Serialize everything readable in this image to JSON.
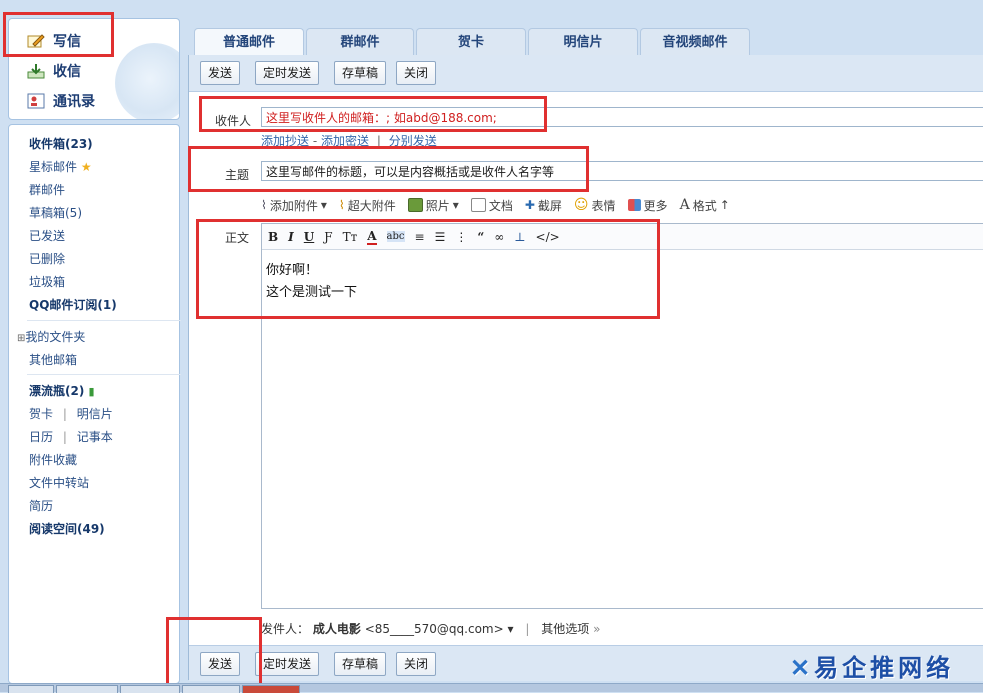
{
  "left_top": {
    "write": "写信",
    "receive": "收信",
    "contacts": "通讯录"
  },
  "nav": {
    "inbox": "收件箱(23)",
    "starred": "星标邮件",
    "group": "群邮件",
    "drafts": "草稿箱(5)",
    "sent": "已发送",
    "deleted": "已删除",
    "trash": "垃圾箱",
    "subscribe": "QQ邮件订阅(1)",
    "my_folders": "我的文件夹",
    "other_mail": "其他邮箱",
    "drift_bottle": "漂流瓶(2)",
    "greeting_card": "贺卡",
    "postcard": "明信片",
    "calendar": "日历",
    "notes": "记事本",
    "attach_fav": "附件收藏",
    "file_transfer": "文件中转站",
    "resume": "简历",
    "reading": "阅读空间(49)",
    "divider": "|"
  },
  "tabs": [
    "普通邮件",
    "群邮件",
    "贺卡",
    "明信片",
    "音视频邮件"
  ],
  "toolbar": {
    "send": "发送",
    "timed_send": "定时发送",
    "save_draft": "存草稿",
    "close": "关闭"
  },
  "compose": {
    "to_label": "收件人",
    "to_value": "这里写收件人的邮箱：; 如abd@188.com;",
    "add_cc": "添加抄送",
    "add_bcc": "添加密送",
    "split_send": "分别发送",
    "subject_label": "主题",
    "subject_value": "这里写邮件的标题，可以是内容概括或是收件人名字等",
    "body_label": "正文",
    "body_line1": "你好啊！",
    "body_line2": "这个是测试一下",
    "dash": "-",
    "bar": "|"
  },
  "attach_bar": {
    "add_attachment": "添加附件",
    "big_attachment": "超大附件",
    "photo": "照片",
    "document": "文档",
    "screenshot": "截屏",
    "emoji": "表情",
    "more": "更多",
    "format": "格式"
  },
  "format_bar": [
    "B",
    "I",
    "U",
    "Ƒ",
    "Tт",
    "A",
    "abc",
    "≡",
    "☰",
    "⋮",
    "“",
    "∞",
    "⊥",
    "</>"
  ],
  "sender": {
    "label": "发件人：",
    "name": "成人电影",
    "email": "<85____570@qq.com>",
    "other_options": "其他选项"
  },
  "watermark": "易企推网络",
  "colors": {
    "annotation_red": "#e03030",
    "nav_blue": "#2a4f86",
    "accent": "#1d3d73"
  }
}
